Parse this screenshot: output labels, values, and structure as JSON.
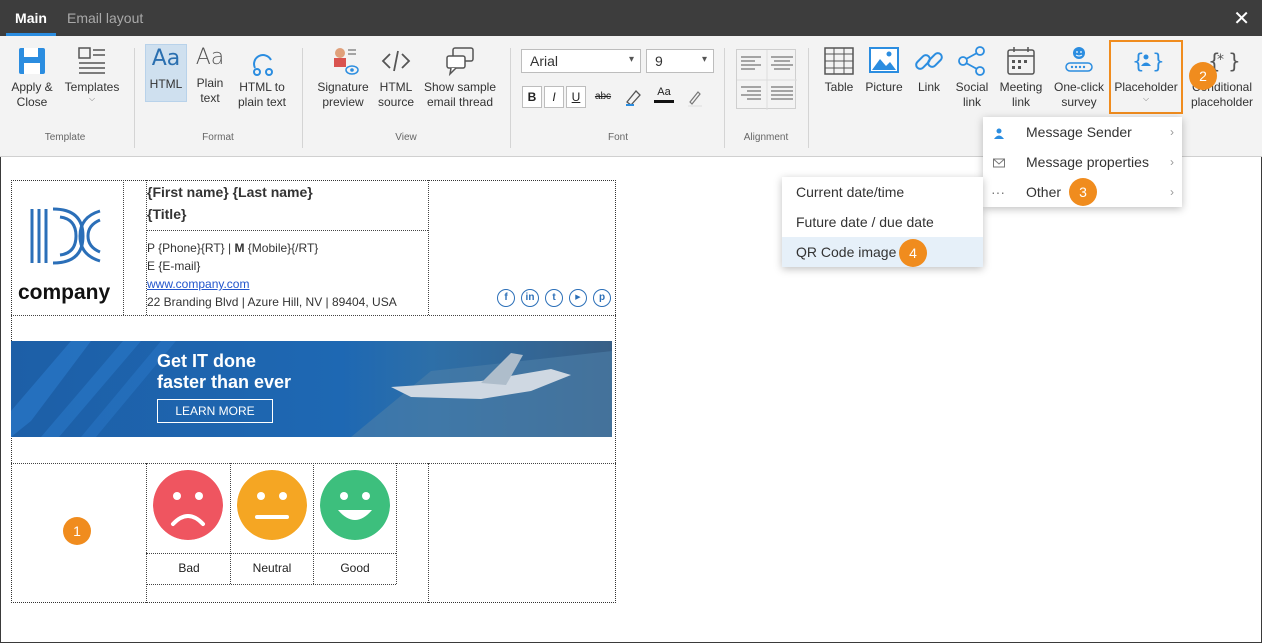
{
  "tabs": {
    "main": "Main",
    "email_layout": "Email layout",
    "close": "✕"
  },
  "ribbon": {
    "apply_close": "Apply &\nClose",
    "templates": "Templates",
    "group_template": "Template",
    "html": "HTML",
    "plain_text": "Plain\ntext",
    "html_to_plain": "HTML to\nplain text",
    "group_format": "Format",
    "signature_preview": "Signature\npreview",
    "html_source": "HTML\nsource",
    "show_sample": "Show sample\nemail thread",
    "group_view": "View",
    "font_name": "Arial",
    "font_size": "9",
    "bold": "B",
    "italic": "I",
    "underline": "U",
    "strike": "abc",
    "group_font": "Font",
    "group_alignment": "Alignment",
    "table": "Table",
    "picture": "Picture",
    "link": "Link",
    "social_link": "Social\nlink",
    "meeting_link": "Meeting\nlink",
    "one_click_survey": "One-click\nsurvey",
    "placeholder": "Placeholder",
    "conditional_placeholder": "Conditional\nplaceholder"
  },
  "menus": {
    "main": [
      {
        "label": "Message Sender",
        "icon": "person-icon"
      },
      {
        "label": "Message properties",
        "icon": "envelope-icon"
      },
      {
        "label": "Other",
        "icon": "dots-icon"
      }
    ],
    "other": [
      {
        "label": "Current date/time"
      },
      {
        "label": "Future date / due date"
      },
      {
        "label": "QR Code image"
      }
    ]
  },
  "badges": {
    "b1": "1",
    "b2": "2",
    "b3": "3",
    "b4": "4"
  },
  "signature": {
    "logo_text": "company",
    "name": "{First name} {Last name}",
    "title": "{Title}",
    "phone_line_p": "P",
    "phone_line_rest": "{Phone}{RT} |",
    "phone_line_m": "M",
    "phone_line_mobile": "{Mobile}{/RT}",
    "email_line": "E {E-mail}",
    "website": "www.company.com",
    "address": "22 Branding Blvd | Azure Hill, NV | 89404, USA",
    "banner_line1": "Get IT done",
    "banner_line2": "faster than ever",
    "banner_button": "LEARN MORE",
    "survey_bad": "Bad",
    "survey_neutral": "Neutral",
    "survey_good": "Good"
  },
  "colors": {
    "accent": "#2b8de0",
    "highlight": "#f08c1e",
    "bad": "#ef5560",
    "neutral": "#f5a623",
    "good": "#3dbf7d"
  }
}
